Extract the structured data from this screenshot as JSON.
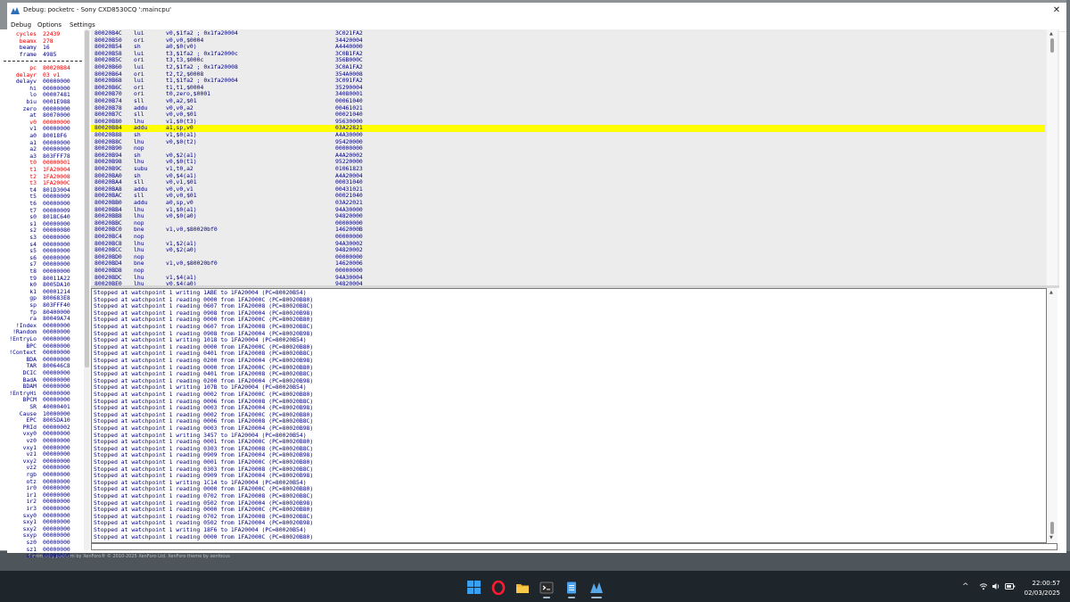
{
  "window": {
    "title": "Debug: pocketrc - Sony CXD8530CQ ':maincpu'",
    "close_glyph": "✕"
  },
  "menu": [
    "Debug",
    "Options",
    "Settings"
  ],
  "background": {
    "footer_text": "Community platform by XenForo® © 2010-2025 XenForo Ltd.     XenForo theme by xenfocus"
  },
  "registers": [
    {
      "name": "cycles",
      "value": "22439",
      "changed": true
    },
    {
      "name": "beamx",
      "value": "278",
      "changed": true
    },
    {
      "name": "beamy",
      "value": "16",
      "changed": false
    },
    {
      "name": "frame",
      "value": "4985",
      "changed": false
    },
    {
      "sep": true
    },
    {
      "name": "pc",
      "value": "80020B84",
      "changed": true
    },
    {
      "name": "delayr",
      "value": "03 v1",
      "changed": true
    },
    {
      "name": "delayv",
      "value": "00000000",
      "changed": false
    },
    {
      "name": "hi",
      "value": "00000000",
      "changed": false
    },
    {
      "name": "lo",
      "value": "00007481",
      "changed": false
    },
    {
      "name": "biu",
      "value": "0001E988",
      "changed": false
    },
    {
      "name": "zero",
      "value": "00000000",
      "changed": false
    },
    {
      "name": "at",
      "value": "80070000",
      "changed": false
    },
    {
      "name": "v0",
      "value": "00000000",
      "changed": true
    },
    {
      "name": "v1",
      "value": "00000000",
      "changed": false
    },
    {
      "name": "a0",
      "value": "80018F6",
      "changed": false
    },
    {
      "name": "a1",
      "value": "00000000",
      "changed": false
    },
    {
      "name": "a2",
      "value": "00000000",
      "changed": false
    },
    {
      "name": "a3",
      "value": "803FFF78",
      "changed": false
    },
    {
      "name": "t0",
      "value": "00000001",
      "changed": true
    },
    {
      "name": "t1",
      "value": "1FA20004",
      "changed": true
    },
    {
      "name": "t2",
      "value": "1FA20008",
      "changed": true
    },
    {
      "name": "t3",
      "value": "1FA2000C",
      "changed": true
    },
    {
      "name": "t4",
      "value": "801D3004",
      "changed": false
    },
    {
      "name": "t5",
      "value": "00000009",
      "changed": false
    },
    {
      "name": "t6",
      "value": "00000000",
      "changed": false
    },
    {
      "name": "t7",
      "value": "00000009",
      "changed": false
    },
    {
      "name": "s0",
      "value": "8018C640",
      "changed": false
    },
    {
      "name": "s1",
      "value": "00000000",
      "changed": false
    },
    {
      "name": "s2",
      "value": "00000080",
      "changed": false
    },
    {
      "name": "s3",
      "value": "00000000",
      "changed": false
    },
    {
      "name": "s4",
      "value": "00000000",
      "changed": false
    },
    {
      "name": "s5",
      "value": "00000000",
      "changed": false
    },
    {
      "name": "s6",
      "value": "00000000",
      "changed": false
    },
    {
      "name": "s7",
      "value": "00000000",
      "changed": false
    },
    {
      "name": "t8",
      "value": "00000000",
      "changed": false
    },
    {
      "name": "t9",
      "value": "80011A22",
      "changed": false
    },
    {
      "name": "k0",
      "value": "8005DA10",
      "changed": false
    },
    {
      "name": "k1",
      "value": "00001214",
      "changed": false
    },
    {
      "name": "gp",
      "value": "800683E8",
      "changed": false
    },
    {
      "name": "sp",
      "value": "803FFF40",
      "changed": false
    },
    {
      "name": "fp",
      "value": "80400000",
      "changed": false
    },
    {
      "name": "ra",
      "value": "80049A74",
      "changed": false
    },
    {
      "name": "!Index",
      "value": "00000000",
      "changed": false
    },
    {
      "name": "!Random",
      "value": "00000000",
      "changed": false
    },
    {
      "name": "!EntryLo",
      "value": "00000000",
      "changed": false
    },
    {
      "name": "BPC",
      "value": "00000000",
      "changed": false
    },
    {
      "name": "!Context",
      "value": "00000000",
      "changed": false
    },
    {
      "name": "BDA",
      "value": "00000000",
      "changed": false
    },
    {
      "name": "TAR",
      "value": "800646C8",
      "changed": false
    },
    {
      "name": "DCIC",
      "value": "00000000",
      "changed": false
    },
    {
      "name": "BadA",
      "value": "00000000",
      "changed": false
    },
    {
      "name": "BDAM",
      "value": "00000000",
      "changed": false
    },
    {
      "name": "!EntryHi",
      "value": "00000000",
      "changed": false
    },
    {
      "name": "BPCM",
      "value": "00000000",
      "changed": false
    },
    {
      "name": "SR",
      "value": "40000401",
      "changed": false
    },
    {
      "name": "Cause",
      "value": "10000000",
      "changed": false
    },
    {
      "name": "EPC",
      "value": "8005DA10",
      "changed": false
    },
    {
      "name": "PRId",
      "value": "00000002",
      "changed": false
    },
    {
      "name": "vxy0",
      "value": "00000000",
      "changed": false
    },
    {
      "name": "vz0",
      "value": "00000000",
      "changed": false
    },
    {
      "name": "vxy1",
      "value": "00000000",
      "changed": false
    },
    {
      "name": "vz1",
      "value": "00000000",
      "changed": false
    },
    {
      "name": "vxy2",
      "value": "00000000",
      "changed": false
    },
    {
      "name": "vz2",
      "value": "00000000",
      "changed": false
    },
    {
      "name": "rgb",
      "value": "00000000",
      "changed": false
    },
    {
      "name": "otz",
      "value": "00000000",
      "changed": false
    },
    {
      "name": "ir0",
      "value": "00000000",
      "changed": false
    },
    {
      "name": "ir1",
      "value": "00000000",
      "changed": false
    },
    {
      "name": "ir2",
      "value": "00000000",
      "changed": false
    },
    {
      "name": "ir3",
      "value": "00000000",
      "changed": false
    },
    {
      "name": "sxy0",
      "value": "00000000",
      "changed": false
    },
    {
      "name": "sxy1",
      "value": "00000000",
      "changed": false
    },
    {
      "name": "sxy2",
      "value": "00000000",
      "changed": false
    },
    {
      "name": "sxyp",
      "value": "00000000",
      "changed": false
    },
    {
      "name": "sz0",
      "value": "00000000",
      "changed": false
    },
    {
      "name": "sz1",
      "value": "00000000",
      "changed": false
    },
    {
      "name": "sz2",
      "value": "00000000",
      "changed": false
    }
  ],
  "disassembly": [
    {
      "addr": "80020B4C",
      "op": "lui",
      "args": "v0,$1fa2 ; 0x1fa20004",
      "hex": "3C021FA2"
    },
    {
      "addr": "80020B50",
      "op": "ori",
      "args": "v0,v0,$0004",
      "hex": "34420004"
    },
    {
      "addr": "80020B54",
      "op": "sh",
      "args": "a0,$0(v0)",
      "hex": "A4440000"
    },
    {
      "addr": "80020B58",
      "op": "lui",
      "args": "t3,$1fa2 ; 0x1fa2000c",
      "hex": "3C0B1FA2"
    },
    {
      "addr": "80020B5C",
      "op": "ori",
      "args": "t3,t3,$000c",
      "hex": "356B000C"
    },
    {
      "addr": "80020B60",
      "op": "lui",
      "args": "t2,$1fa2 ; 0x1fa20008",
      "hex": "3C0A1FA2"
    },
    {
      "addr": "80020B64",
      "op": "ori",
      "args": "t2,t2,$0008",
      "hex": "354A0008"
    },
    {
      "addr": "80020B68",
      "op": "lui",
      "args": "t1,$1fa2 ; 0x1fa20004",
      "hex": "3C091FA2"
    },
    {
      "addr": "80020B6C",
      "op": "ori",
      "args": "t1,t1,$0004",
      "hex": "35290004"
    },
    {
      "addr": "80020B70",
      "op": "ori",
      "args": "t0,zero,$0001",
      "hex": "34080001"
    },
    {
      "addr": "80020B74",
      "op": "sll",
      "args": "v0,a2,$01",
      "hex": "00061040"
    },
    {
      "addr": "80020B78",
      "op": "addu",
      "args": "v0,v0,a2",
      "hex": "00461021"
    },
    {
      "addr": "80020B7C",
      "op": "sll",
      "args": "v0,v0,$01",
      "hex": "00021040"
    },
    {
      "addr": "80020B80",
      "op": "lhu",
      "args": "v1,$0(t3)",
      "hex": "95630000"
    },
    {
      "addr": "80020B84",
      "op": "addu",
      "args": "a1,sp,v0",
      "hex": "03A22821",
      "current": true
    },
    {
      "addr": "80020B88",
      "op": "sh",
      "args": "v1,$0(a1)",
      "hex": "A4A30000"
    },
    {
      "addr": "80020B8C",
      "op": "lhu",
      "args": "v0,$0(t2)",
      "hex": "95420000"
    },
    {
      "addr": "80020B90",
      "op": "nop",
      "args": "",
      "hex": "00000000"
    },
    {
      "addr": "80020B94",
      "op": "sh",
      "args": "v0,$2(a1)",
      "hex": "A4A20002"
    },
    {
      "addr": "80020B98",
      "op": "lhu",
      "args": "v0,$0(t1)",
      "hex": "95220000"
    },
    {
      "addr": "80020B9C",
      "op": "subu",
      "args": "v1,t0,a2",
      "hex": "01061823"
    },
    {
      "addr": "80020BA0",
      "op": "sh",
      "args": "v0,$4(a1)",
      "hex": "A4A20004"
    },
    {
      "addr": "80020BA4",
      "op": "sll",
      "args": "v0,v1,$01",
      "hex": "00031040"
    },
    {
      "addr": "80020BA8",
      "op": "addu",
      "args": "v0,v0,v1",
      "hex": "00431021"
    },
    {
      "addr": "80020BAC",
      "op": "sll",
      "args": "v0,v0,$01",
      "hex": "00021040"
    },
    {
      "addr": "80020BB0",
      "op": "addu",
      "args": "a0,sp,v0",
      "hex": "03A22021"
    },
    {
      "addr": "80020BB4",
      "op": "lhu",
      "args": "v1,$0(a1)",
      "hex": "94A30000"
    },
    {
      "addr": "80020BB8",
      "op": "lhu",
      "args": "v0,$0(a0)",
      "hex": "94820000"
    },
    {
      "addr": "80020BBC",
      "op": "nop",
      "args": "",
      "hex": "00000000"
    },
    {
      "addr": "80020BC0",
      "op": "bne",
      "args": "v1,v0,$80020bf0",
      "hex": "1462000B"
    },
    {
      "addr": "80020BC4",
      "op": "nop",
      "args": "",
      "hex": "00000000"
    },
    {
      "addr": "80020BC8",
      "op": "lhu",
      "args": "v1,$2(a1)",
      "hex": "94A30002"
    },
    {
      "addr": "80020BCC",
      "op": "lhu",
      "args": "v0,$2(a0)",
      "hex": "94820002"
    },
    {
      "addr": "80020BD0",
      "op": "nop",
      "args": "",
      "hex": "00000000"
    },
    {
      "addr": "80020BD4",
      "op": "bne",
      "args": "v1,v0,$80020bf0",
      "hex": "14620006"
    },
    {
      "addr": "80020BD8",
      "op": "nop",
      "args": "",
      "hex": "00000000"
    },
    {
      "addr": "80020BDC",
      "op": "lhu",
      "args": "v1,$4(a1)",
      "hex": "94A30004"
    },
    {
      "addr": "80020BE0",
      "op": "lhu",
      "args": "v0,$4(a0)",
      "hex": "94820004"
    }
  ],
  "log": [
    "Stopped at watchpoint 1 writing 1ABE to 1FA20004 (PC=80020B54)",
    "Stopped at watchpoint 1 reading 0000 from 1FA2000C (PC=80020B80)",
    "Stopped at watchpoint 1 reading 0607 from 1FA20008 (PC=80020B8C)",
    "Stopped at watchpoint 1 reading 0908 from 1FA20004 (PC=80020B98)",
    "Stopped at watchpoint 1 reading 0000 from 1FA2000C (PC=80020B80)",
    "Stopped at watchpoint 1 reading 0607 from 1FA20008 (PC=80020B8C)",
    "Stopped at watchpoint 1 reading 0908 from 1FA20004 (PC=80020B98)",
    "Stopped at watchpoint 1 writing 1018 to 1FA20004 (PC=80020B54)",
    "Stopped at watchpoint 1 reading 0000 from 1FA2000C (PC=80020B80)",
    "Stopped at watchpoint 1 reading 0401 from 1FA20008 (PC=80020B8C)",
    "Stopped at watchpoint 1 reading 0200 from 1FA20004 (PC=80020B98)",
    "Stopped at watchpoint 1 reading 0000 from 1FA2000C (PC=80020B80)",
    "Stopped at watchpoint 1 reading 0401 from 1FA20008 (PC=80020B8C)",
    "Stopped at watchpoint 1 reading 0200 from 1FA20004 (PC=80020B98)",
    "Stopped at watchpoint 1 writing 107B to 1FA20004 (PC=80020B54)",
    "Stopped at watchpoint 1 reading 0002 from 1FA2000C (PC=80020B80)",
    "Stopped at watchpoint 1 reading 0006 from 1FA20008 (PC=80020B8C)",
    "Stopped at watchpoint 1 reading 0003 from 1FA20004 (PC=80020B98)",
    "Stopped at watchpoint 1 reading 0002 from 1FA2000C (PC=80020B80)",
    "Stopped at watchpoint 1 reading 0006 from 1FA20008 (PC=80020B8C)",
    "Stopped at watchpoint 1 reading 0003 from 1FA20004 (PC=80020B98)",
    "Stopped at watchpoint 1 writing 3457 to 1FA20004 (PC=80020B54)",
    "Stopped at watchpoint 1 reading 0001 from 1FA2000C (PC=80020B80)",
    "Stopped at watchpoint 1 reading 0303 from 1FA20008 (PC=80020B8C)",
    "Stopped at watchpoint 1 reading 0909 from 1FA20004 (PC=80020B98)",
    "Stopped at watchpoint 1 reading 0001 from 1FA2000C (PC=80020B80)",
    "Stopped at watchpoint 1 reading 0303 from 1FA20008 (PC=80020B8C)",
    "Stopped at watchpoint 1 reading 0909 from 1FA20004 (PC=80020B98)",
    "Stopped at watchpoint 1 writing 1C14 to 1FA20004 (PC=80020B54)",
    "Stopped at watchpoint 1 reading 0000 from 1FA2000C (PC=80020B80)",
    "Stopped at watchpoint 1 reading 0702 from 1FA20008 (PC=80020B8C)",
    "Stopped at watchpoint 1 reading 0502 from 1FA20004 (PC=80020B98)",
    "Stopped at watchpoint 1 reading 0000 from 1FA2000C (PC=80020B80)",
    "Stopped at watchpoint 1 reading 0702 from 1FA20008 (PC=80020B8C)",
    "Stopped at watchpoint 1 reading 0502 from 1FA20004 (PC=80020B98)",
    "Stopped at watchpoint 1 writing 18F6 to 1FA20004 (PC=80020B54)",
    "Stopped at watchpoint 1 reading 0000 from 1FA2000C (PC=80020B80)"
  ],
  "taskbar": {
    "apps": [
      "windows-start",
      "opera",
      "file-explorer",
      "terminal",
      "notepad",
      "mame-debugger"
    ],
    "tray_chevron": "^",
    "time": "22:00:57",
    "date": "02/03/2025"
  },
  "colors": {
    "register_text": "#000080",
    "register_changed": "#e00000",
    "current_line": "#ffff00",
    "disasm_background": "#ececec"
  }
}
